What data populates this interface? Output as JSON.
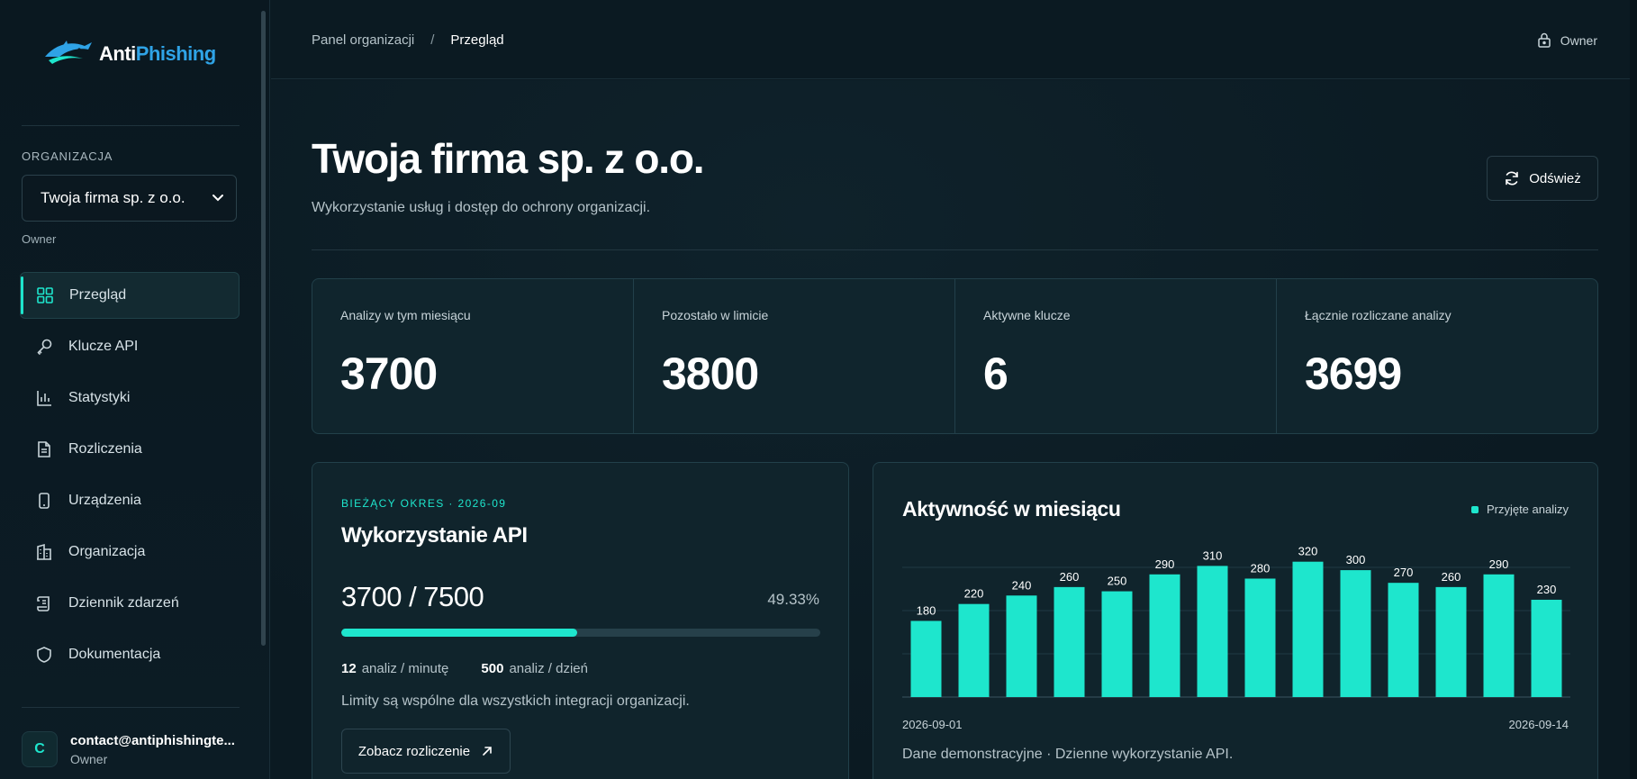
{
  "brand": {
    "name_part1": "Anti",
    "name_part2": "Phishing",
    "accent": "#1ee6cd",
    "logo_blue": "#2fa3e6"
  },
  "sidebar": {
    "org_label": "ORGANIZACJA",
    "org_selected": "Twoja firma sp. z o.o.",
    "org_role": "Owner",
    "items": [
      {
        "label": "Przegląd",
        "icon": "grid-icon",
        "active": true
      },
      {
        "label": "Klucze API",
        "icon": "key-icon"
      },
      {
        "label": "Statystyki",
        "icon": "bar-chart-icon"
      },
      {
        "label": "Rozliczenia",
        "icon": "document-icon"
      },
      {
        "label": "Urządzenia",
        "icon": "tablet-icon"
      },
      {
        "label": "Organizacja",
        "icon": "building-icon"
      },
      {
        "label": "Dziennik zdarzeń",
        "icon": "scroll-icon"
      },
      {
        "label": "Dokumentacja",
        "icon": "shield-icon"
      }
    ],
    "user": {
      "initial": "C",
      "email": "contact@antiphishingte...",
      "role": "Owner"
    }
  },
  "topbar": {
    "breadcrumb": [
      "Panel organizacji",
      "Przegląd"
    ],
    "separator": "/",
    "role": "Owner"
  },
  "header": {
    "title": "Twoja firma sp. z o.o.",
    "subtitle": "Wykorzystanie usług i dostęp do ochrony organizacji.",
    "refresh_label": "Odśwież"
  },
  "stats": [
    {
      "label": "Analizy w tym miesiącu",
      "value": "3700"
    },
    {
      "label": "Pozostało w limicie",
      "value": "3800"
    },
    {
      "label": "Aktywne klucze",
      "value": "6"
    },
    {
      "label": "Łącznie rozliczane analizy",
      "value": "3699"
    }
  ],
  "api_card": {
    "kicker": "BIEŻĄCY OKRES · 2026-09",
    "title": "Wykorzystanie API",
    "usage": "3700 / 7500",
    "percent": "49.33%",
    "progress": 0.4933,
    "per_minute_value": "12",
    "per_minute_label": "analiz / minutę",
    "per_day_value": "500",
    "per_day_label": "analiz / dzień",
    "note": "Limity są wspólne dla wszystkich integracji organizacji.",
    "billing_button": "Zobacz rozliczenie"
  },
  "chart_card": {
    "title": "Aktywność w miesiącu",
    "legend": "Przyjęte analizy",
    "x_start": "2026-09-01",
    "x_end": "2026-09-14",
    "note": "Dane demonstracyjne · Dzienne wykorzystanie API."
  },
  "chart_data": {
    "type": "bar",
    "title": "Aktywność w miesiącu",
    "series": [
      {
        "name": "Przyjęte analizy",
        "values": [
          180,
          220,
          240,
          260,
          250,
          290,
          310,
          280,
          320,
          300,
          270,
          260,
          290,
          230
        ]
      }
    ],
    "ylim": [
      0,
      330
    ],
    "grid": true,
    "legend_position": "top-right",
    "color": "#1ee6cd"
  }
}
